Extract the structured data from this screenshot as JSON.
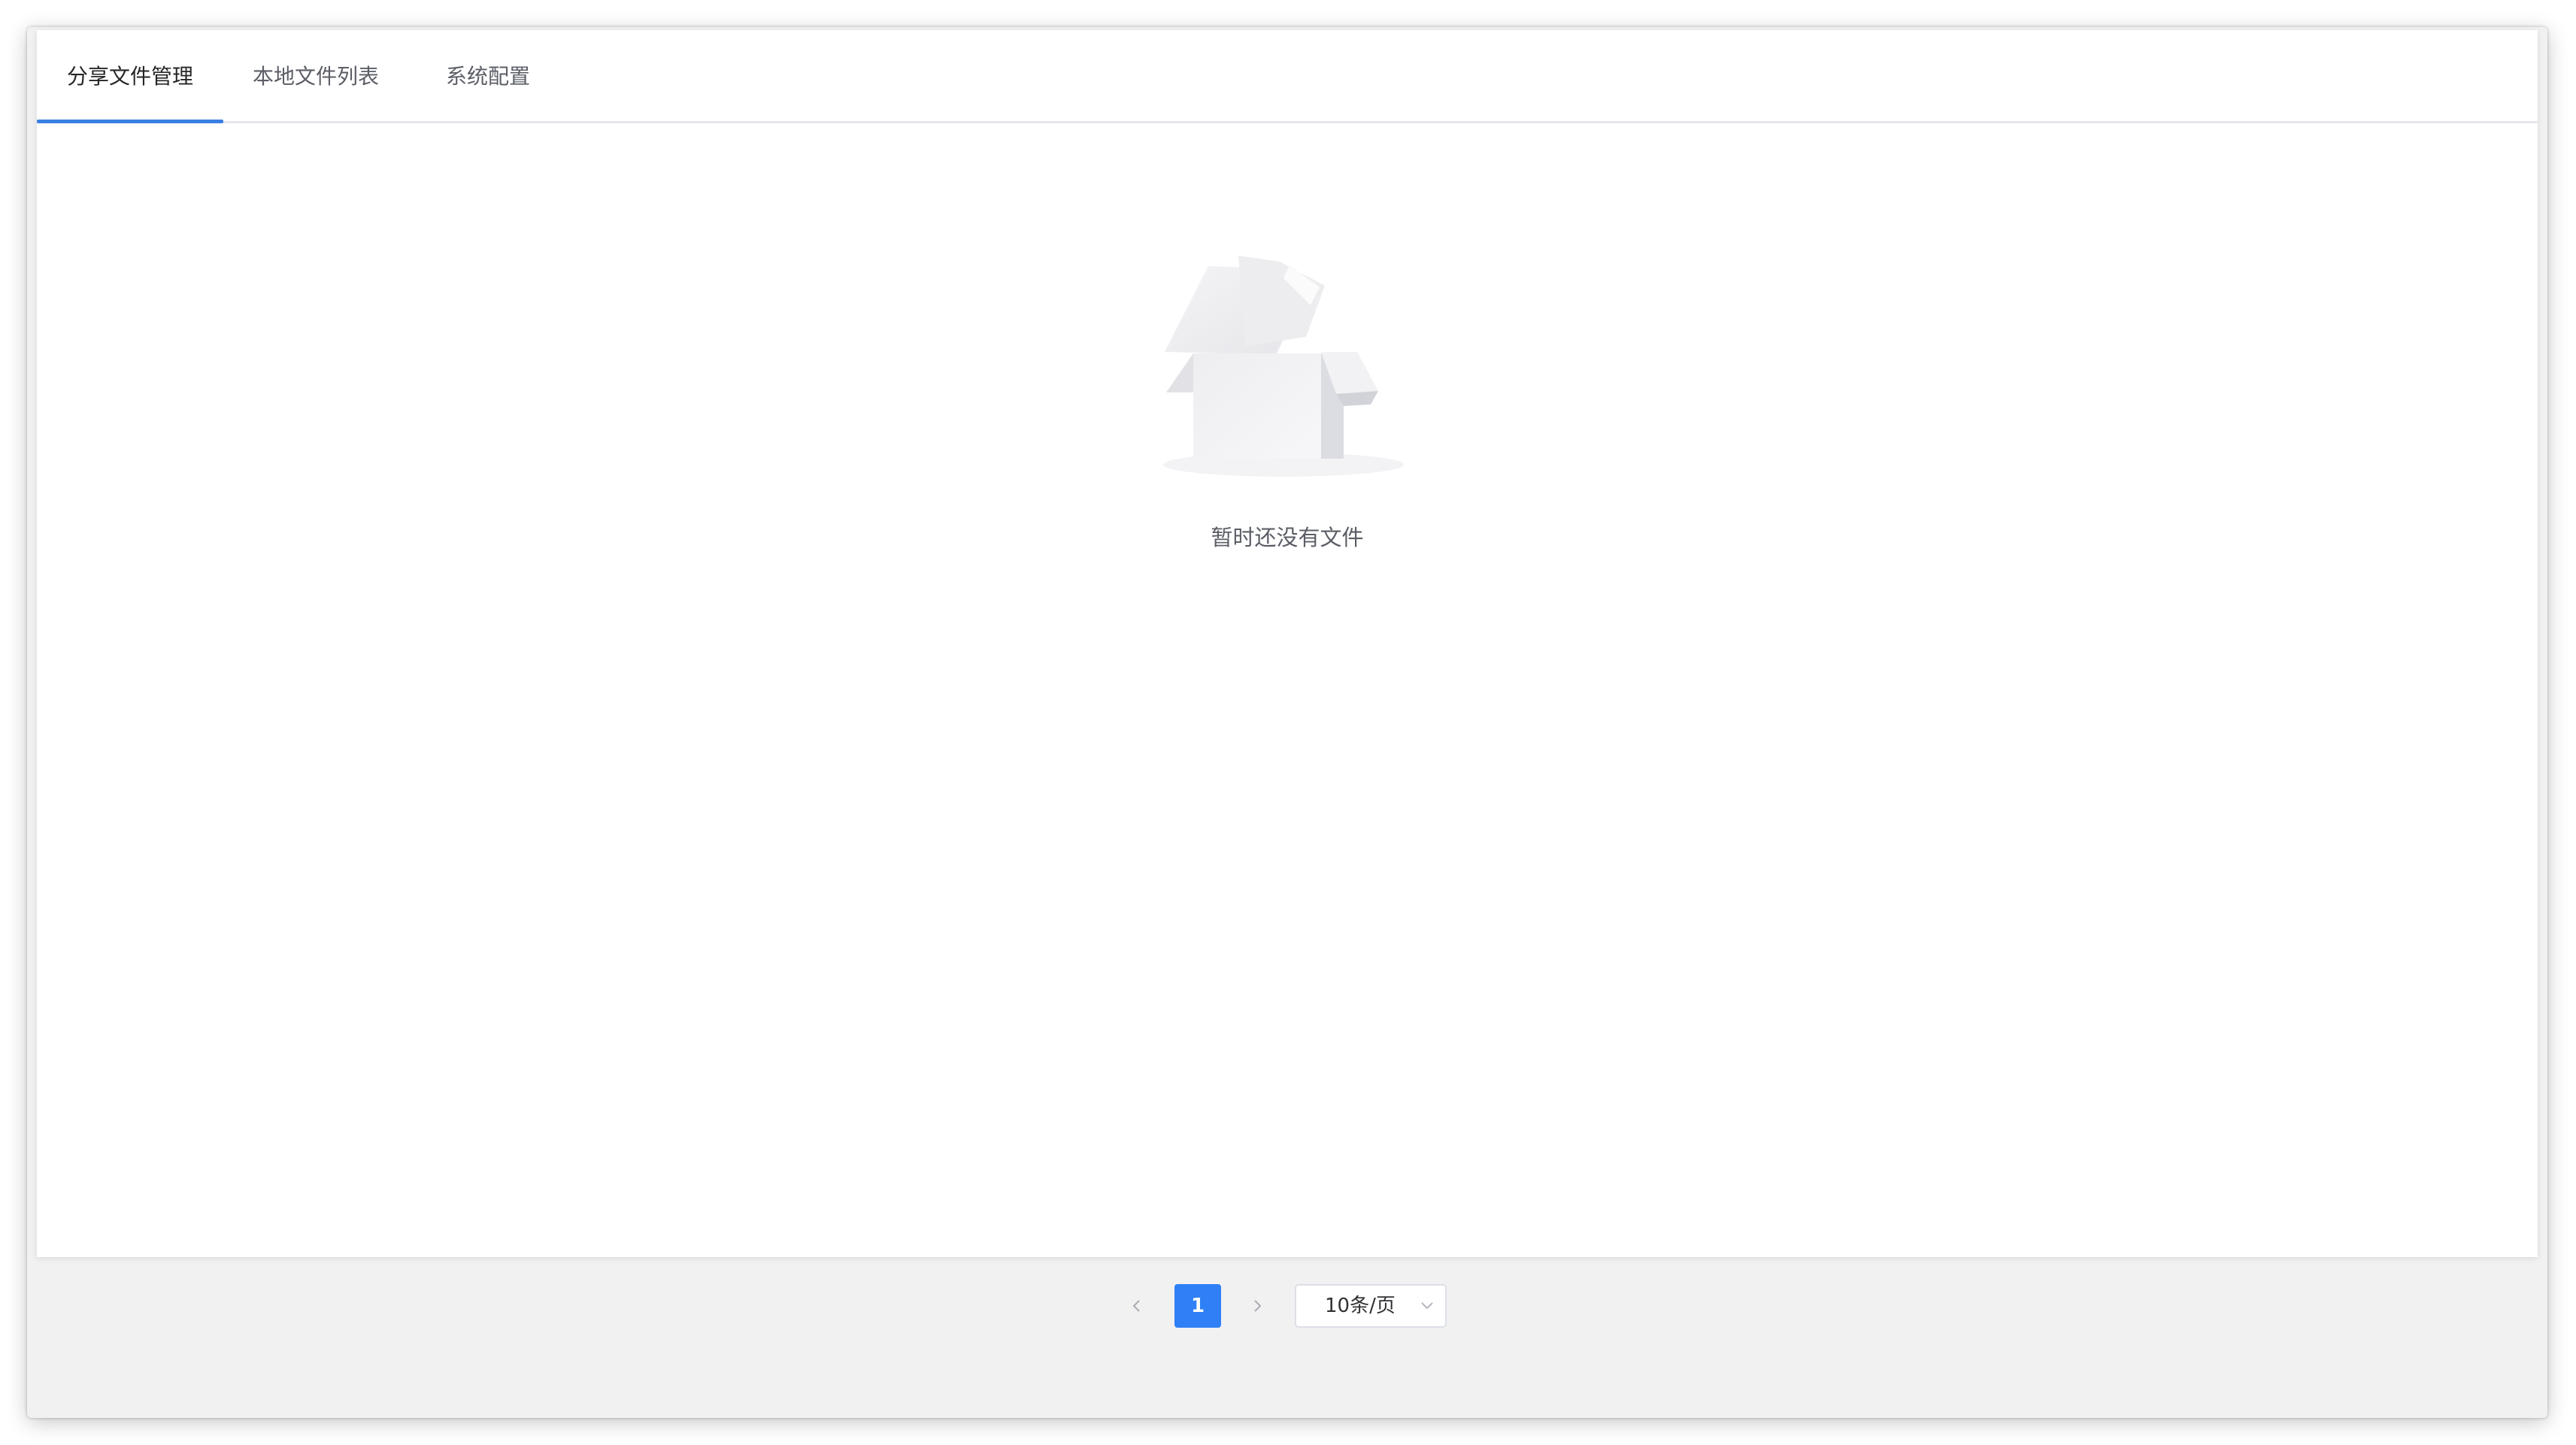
{
  "tabs": [
    {
      "label": "分享文件管理",
      "active": true
    },
    {
      "label": "本地文件列表",
      "active": false
    },
    {
      "label": "系统配置",
      "active": false
    }
  ],
  "empty_state": {
    "icon": "empty-box-icon",
    "message": "暂时还没有文件"
  },
  "pagination": {
    "current_page": "1",
    "page_size_label": "10条/页",
    "prev_icon": "chevron-left-icon",
    "next_icon": "chevron-right-icon",
    "select_icon": "chevron-down-icon"
  },
  "colors": {
    "accent": "#2f80f6",
    "tab_indicator": "#3a7fe4",
    "window_background": "#f1f1f2",
    "card_background": "#ffffff"
  }
}
